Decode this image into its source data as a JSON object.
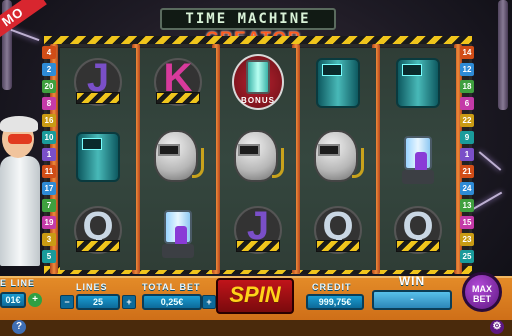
{
  "demo_label": "MO",
  "game_title": {
    "line1": "TIME MACHINE",
    "line2": "CREATOR"
  },
  "reels": [
    [
      "J",
      "machine",
      "Q"
    ],
    [
      "K",
      "helmet",
      "lantern"
    ],
    [
      "bonus",
      "helmet",
      "J"
    ],
    [
      "machine",
      "helmet",
      "Q"
    ],
    [
      "machine",
      "lantern",
      "Q"
    ]
  ],
  "symbol_colors": {
    "J": "#7a4fc8",
    "K": "#d83a9c",
    "Q": "#c9d7e4"
  },
  "bonus_label": "BONUS",
  "left_paylines": [
    "4",
    "2",
    "20",
    "8",
    "16",
    "10",
    "1",
    "11",
    "17",
    "7",
    "19",
    "3",
    "5"
  ],
  "right_paylines": [
    "14",
    "12",
    "18",
    "6",
    "22",
    "9",
    "1",
    "21",
    "24",
    "13",
    "15",
    "23",
    "25"
  ],
  "payline_colors": [
    "#d14d17",
    "#2e8bd6",
    "#3fa03f",
    "#c43aa8",
    "#c99b14",
    "#1a9b9b",
    "#7a4fc8"
  ],
  "panel": {
    "bet_line_label": "E LINE",
    "bet_line_value": "01€",
    "lines_label": "LINES",
    "lines_value": "25",
    "total_bet_label": "TOTAL BET",
    "total_bet_value": "0,25€",
    "spin_label": "SPIN",
    "credit_label": "CREDIT",
    "credit_value": "999,75€",
    "win_label": "WIN",
    "win_value": "-",
    "max_bet_line1": "MAX",
    "max_bet_line2": "BET",
    "plus": "+",
    "minus": "−",
    "help": "?"
  }
}
